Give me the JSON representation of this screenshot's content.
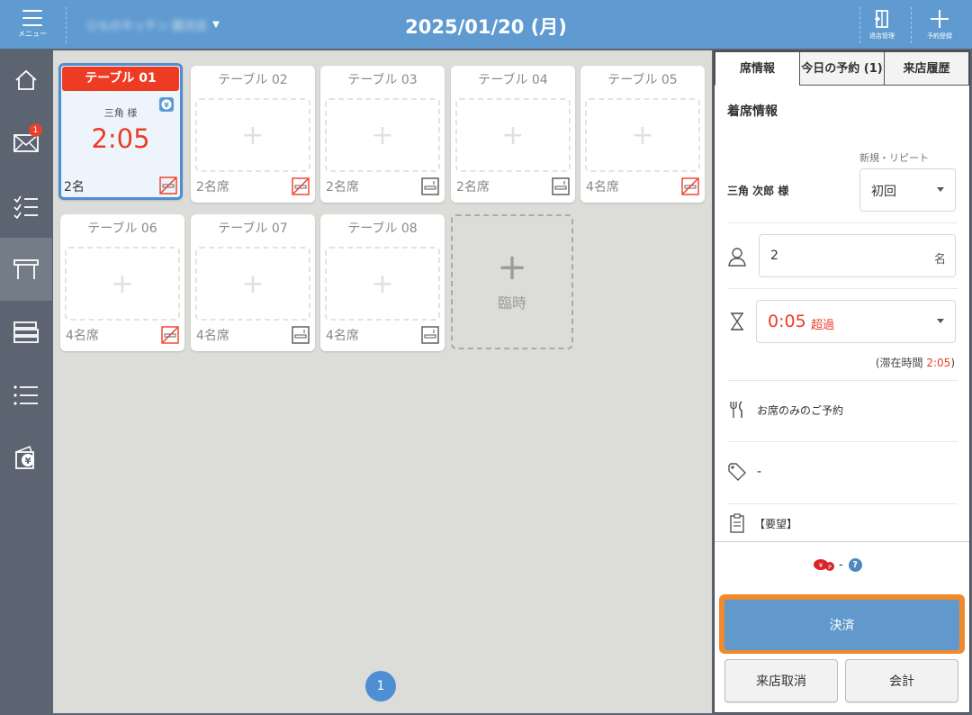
{
  "header": {
    "menu_label": "メニュー",
    "store_name": "ひものキッチン 銀次店",
    "date": "2025/01/20 (月)",
    "store_mgmt_label": "退店管理",
    "reserve_label": "予約登録"
  },
  "sidenav": {
    "mail_badge": "1"
  },
  "tables": [
    {
      "name": "テーブル 01",
      "guest": "三角 様",
      "time": "2:05",
      "seats": "2名",
      "selected": true
    },
    {
      "name": "テーブル 02",
      "seats": "2名席"
    },
    {
      "name": "テーブル 03",
      "seats": "2名席"
    },
    {
      "name": "テーブル 04",
      "seats": "2名席"
    },
    {
      "name": "テーブル 05",
      "seats": "4名席"
    },
    {
      "name": "テーブル 06",
      "seats": "4名席"
    },
    {
      "name": "テーブル 07",
      "seats": "4名席"
    },
    {
      "name": "テーブル 08",
      "seats": "4名席"
    }
  ],
  "temp_card": {
    "plus": "+",
    "label": "臨時"
  },
  "pager": {
    "page": "1"
  },
  "panel": {
    "tabs": [
      "席情報",
      "今日の予約 (1)",
      "来店履歴"
    ],
    "section_title": "着席情報",
    "customer_name": "三角 次郎 様",
    "visit_type_label": "新規・リピート",
    "visit_type_value": "初回",
    "party_size": "2",
    "party_unit": "名",
    "elapsed": "0:05",
    "elapsed_status": "超過",
    "stay_prefix": "(滞在時間 ",
    "stay_value": "2:05",
    "stay_suffix": ")",
    "course": "お席のみのご予約",
    "tag": "-",
    "request": "【要望】",
    "points": "-",
    "pay_button": "決済",
    "cancel_button": "来店取消",
    "checkout_button": "会計"
  },
  "colors": {
    "header": "#5f9bd0",
    "accent_red": "#ee3b24",
    "selected_border": "#4f8fd0",
    "pay_button": "#6199cc",
    "highlight_orange": "#ef8a2d"
  }
}
